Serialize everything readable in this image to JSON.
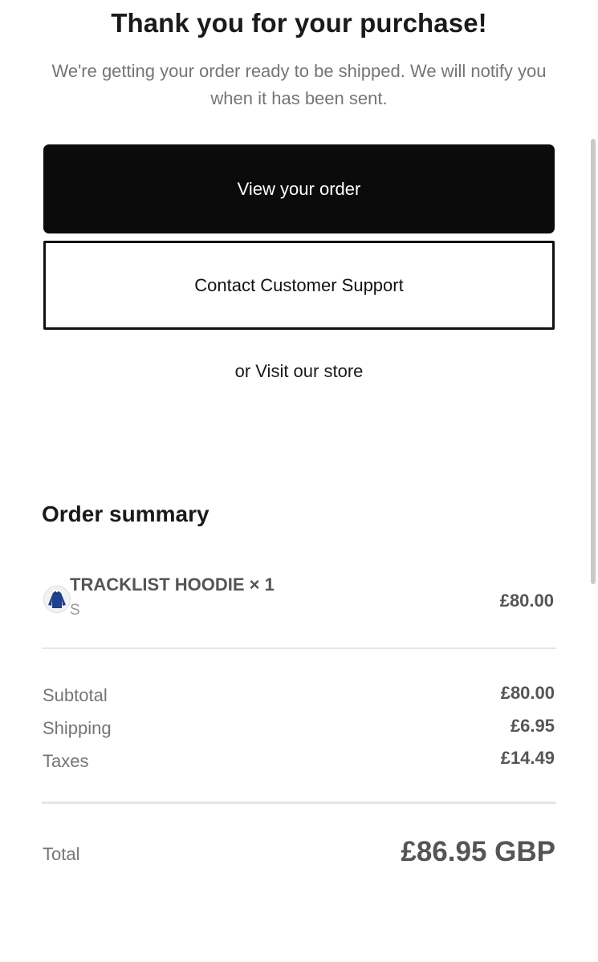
{
  "header": {
    "title": "Thank you for your purchase!",
    "subtitle": "We're getting your order ready to be shipped. We will notify you when it has been sent."
  },
  "actions": {
    "view_order_label": "View your order",
    "contact_support_label": "Contact Customer Support",
    "visit_store_label": "or Visit our store"
  },
  "order_summary": {
    "heading": "Order summary",
    "items": [
      {
        "name": "TRACKLIST HOODIE × 1",
        "variant": "S",
        "price": "£80.00",
        "thumbnail_icon": "hoodie-icon"
      }
    ],
    "rows": [
      {
        "label": "Subtotal",
        "value": "£80.00"
      },
      {
        "label": "Shipping",
        "value": "£6.95"
      },
      {
        "label": "Taxes",
        "value": "£14.49"
      }
    ],
    "total": {
      "label": "Total",
      "value": "£86.95 GBP"
    }
  },
  "colors": {
    "primary_button_bg": "#0b0b0b",
    "muted_text": "#757575",
    "value_text": "#555555",
    "divider": "#e6e6e6",
    "thumbnail_item": "#1f3f8f"
  }
}
